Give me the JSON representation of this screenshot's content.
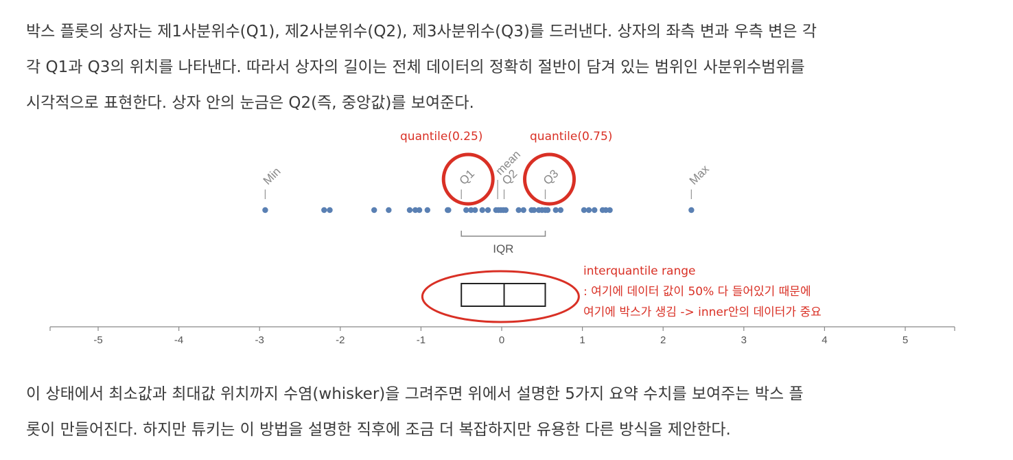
{
  "intro": {
    "lines": [
      "박스 플롯의 상자는 제1사분위수(Q1), 제2사분위수(Q2), 제3사분위수(Q3)를 드러낸다. 상자의 좌측 변과 우측 변은 각",
      "각 Q1과 Q3의 위치를 나타낸다. 따라서 상자의 길이는 전체 데이터의 정확히 절반이 담겨 있는 범위인 사분위수범위를",
      "시각적으로 표현한다. 상자 안의 눈금은 Q2(즉, 중앙값)를 보여준다."
    ]
  },
  "figure": {
    "markers": {
      "min": "Min",
      "q1": "Q1",
      "mean": "mean",
      "q2": "Q2",
      "q3": "Q3",
      "max": "Max"
    },
    "iqr_label": "IQR",
    "axis": {
      "ticks": [
        -5,
        -4,
        -3,
        -2,
        -1,
        0,
        1,
        2,
        3,
        4,
        5
      ]
    },
    "stats": {
      "min": -2.93,
      "q1": -0.5,
      "mean": -0.05,
      "median": 0.03,
      "q3": 0.54,
      "max": 2.35
    },
    "points": [
      -2.93,
      -2.2,
      -2.13,
      -1.58,
      -1.4,
      -1.14,
      -1.07,
      -1.02,
      -0.92,
      -0.67,
      -0.66,
      -0.44,
      -0.38,
      -0.33,
      -0.24,
      -0.17,
      -0.07,
      -0.04,
      -0.01,
      0.02,
      0.05,
      0.21,
      0.27,
      0.37,
      0.4,
      0.46,
      0.5,
      0.54,
      0.57,
      0.67,
      0.73,
      1.02,
      1.08,
      1.15,
      1.25,
      1.29,
      1.34,
      2.35
    ],
    "box": {
      "q1": -0.5,
      "median": 0.03,
      "q3": 0.54
    }
  },
  "annotations": {
    "q1_quantile": "quantile(0.25)",
    "q3_quantile": "quantile(0.75)",
    "iqr_note": [
      "interquantile range",
      ": 여기에 데이터 값이 50% 다 들어있기 때문에",
      "여기에 박스가 생김 -> inner안의 데이터가 중요"
    ]
  },
  "colors": {
    "annotation_red": "#d93025",
    "point_blue": "#5a80b3",
    "axis_gray": "#888888",
    "text": "#3a3a3a"
  },
  "outro": {
    "lines": [
      "이 상태에서 최소값과 최대값 위치까지 수염(whisker)을 그려주면 위에서 설명한 5가지 요약 수치를 보여주는 박스 플",
      "롯이 만들어진다. 하지만 튜키는 이 방법을 설명한 직후에 조금 더 복잡하지만 유용한 다른 방식을 제안한다."
    ]
  }
}
